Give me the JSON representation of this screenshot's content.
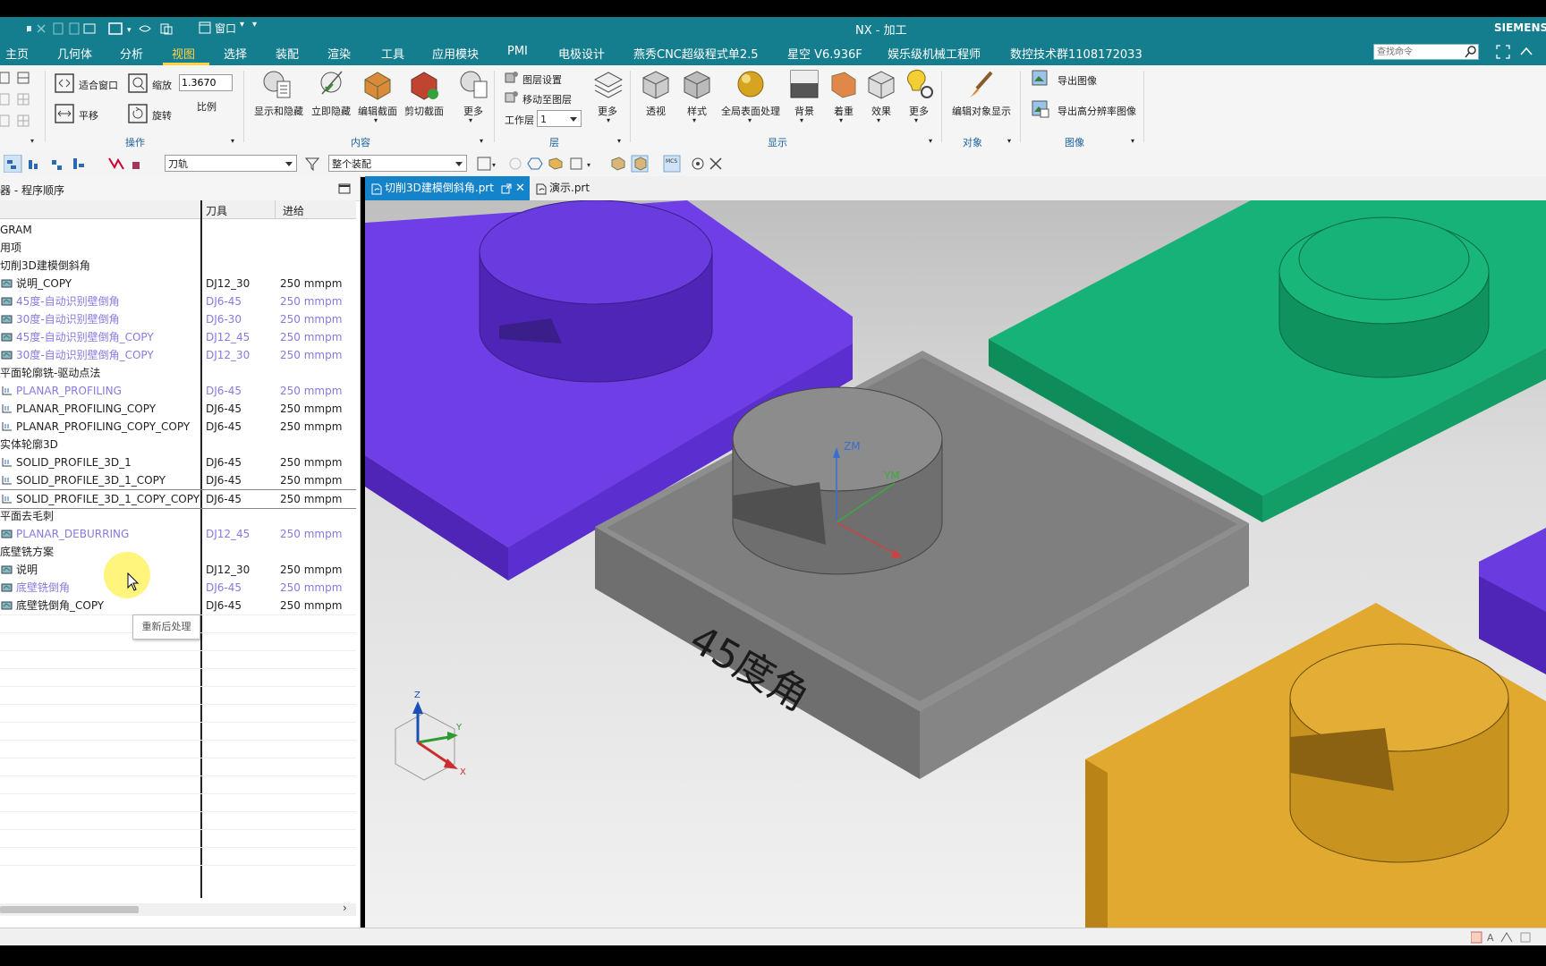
{
  "titlebar": {
    "title": "NX - 加工",
    "brand": "SIEMENS",
    "window_menu": "窗口"
  },
  "menubar": {
    "items": [
      "主页",
      "几何体",
      "分析",
      "视图",
      "选择",
      "装配",
      "渲染",
      "工具",
      "应用模块",
      "PMI",
      "电极设计",
      "燕秀CNC超级程式单2.5",
      "星空 V6.936F",
      "娱乐级机械工程师",
      "数控技术群1108172033"
    ],
    "active_index": 3,
    "search_placeholder": "查找命令"
  },
  "ribbon": {
    "operate": {
      "fit": "适合窗口",
      "zoom": "缩放",
      "zoom_value": "1.3670",
      "scale": "比例",
      "pan": "平移",
      "rotate": "旋转",
      "group": "操作"
    },
    "content": {
      "show_hide": "显示和隐藏",
      "immediate_hide": "立即隐藏",
      "edit_section": "编辑截面",
      "clip_section": "剪切截面",
      "more": "更多",
      "group": "内容"
    },
    "layer": {
      "settings": "图层设置",
      "move": "移动至图层",
      "work_layer_label": "工作层",
      "work_layer_value": "1",
      "more": "更多",
      "group": "层"
    },
    "display": {
      "perspective": "透视",
      "style": "样式",
      "global_surface": "全局表面处理",
      "background": "背景",
      "color": "着重",
      "effect": "效果",
      "more": "更多",
      "group": "显示"
    },
    "object": {
      "edit_display": "编辑对象显示",
      "group": "对象"
    },
    "image": {
      "export": "导出图像",
      "export_hi": "导出高分辨率图像",
      "group": "图像"
    }
  },
  "toolbar2": {
    "filter_value": "刀轨",
    "scope_value": "整个装配"
  },
  "navigator": {
    "title": "器 - 程序顺序",
    "col_tool": "刀具",
    "col_feed": "进给",
    "rows": [
      {
        "name": "GRAM",
        "tool": "",
        "feed": "",
        "muted": false,
        "icon": "none"
      },
      {
        "name": "用项",
        "tool": "",
        "feed": "",
        "muted": false,
        "icon": "none"
      },
      {
        "name": "切削3D建模倒斜角",
        "tool": "",
        "feed": "",
        "muted": false,
        "icon": "none"
      },
      {
        "name": "说明_COPY",
        "tool": "DJ12_30",
        "feed": "250 mmpm",
        "muted": false,
        "icon": "op"
      },
      {
        "name": "45度-自动识别壁倒角",
        "tool": "DJ6-45",
        "feed": "250 mmpm",
        "muted": true,
        "icon": "op"
      },
      {
        "name": "30度-自动识别壁倒角",
        "tool": "DJ6-30",
        "feed": "250 mmpm",
        "muted": true,
        "icon": "op"
      },
      {
        "name": "45度-自动识别壁倒角_COPY",
        "tool": "DJ12_45",
        "feed": "250 mmpm",
        "muted": true,
        "icon": "op"
      },
      {
        "name": "30度-自动识别壁倒角_COPY",
        "tool": "DJ12_30",
        "feed": "250 mmpm",
        "muted": true,
        "icon": "op"
      },
      {
        "name": "平面轮廓铣-驱动点法",
        "tool": "",
        "feed": "",
        "muted": false,
        "icon": "none"
      },
      {
        "name": "PLANAR_PROFILING",
        "tool": "DJ6-45",
        "feed": "250 mmpm",
        "muted": true,
        "icon": "prof"
      },
      {
        "name": "PLANAR_PROFILING_COPY",
        "tool": "DJ6-45",
        "feed": "250 mmpm",
        "muted": false,
        "icon": "prof"
      },
      {
        "name": "PLANAR_PROFILING_COPY_COPY",
        "tool": "DJ6-45",
        "feed": "250 mmpm",
        "muted": false,
        "icon": "prof"
      },
      {
        "name": "实体轮廓3D",
        "tool": "",
        "feed": "",
        "muted": false,
        "icon": "none"
      },
      {
        "name": "SOLID_PROFILE_3D_1",
        "tool": "DJ6-45",
        "feed": "250 mmpm",
        "muted": false,
        "icon": "prof"
      },
      {
        "name": "SOLID_PROFILE_3D_1_COPY",
        "tool": "DJ6-45",
        "feed": "250 mmpm",
        "muted": false,
        "icon": "prof"
      },
      {
        "name": "SOLID_PROFILE_3D_1_COPY_COPY",
        "tool": "DJ6-45",
        "feed": "250 mmpm",
        "muted": false,
        "icon": "prof"
      },
      {
        "name": "平面去毛刺",
        "tool": "",
        "feed": "",
        "muted": false,
        "icon": "none"
      },
      {
        "name": "PLANAR_DEBURRING",
        "tool": "DJ12_45",
        "feed": "250 mmpm",
        "muted": true,
        "icon": "op"
      },
      {
        "name": "底壁铣方案",
        "tool": "",
        "feed": "",
        "muted": false,
        "icon": "none"
      },
      {
        "name": "说明",
        "tool": "DJ12_30",
        "feed": "250 mmpm",
        "muted": false,
        "icon": "op"
      },
      {
        "name": "底壁铣倒角",
        "tool": "DJ6-45",
        "feed": "250 mmpm",
        "muted": true,
        "icon": "op"
      },
      {
        "name": "底壁铣倒角_COPY",
        "tool": "DJ6-45",
        "feed": "250 mmpm",
        "muted": false,
        "icon": "op"
      }
    ],
    "tooltip": "重新后处理"
  },
  "viewtabs": {
    "tabs": [
      "切削3D建模倒斜角.prt",
      "演示.prt"
    ]
  },
  "viewport": {
    "engraving": "45度角",
    "wcs_z": "ZM",
    "wcs_y": "YM",
    "triad_x": "X",
    "triad_y": "Y",
    "triad_z": "Z"
  },
  "colors": {
    "menubar": "#147d8e",
    "accent": "#ffd24a",
    "tab_active": "#1583c9",
    "part_purple": "#6a3ce0",
    "part_green": "#16b176",
    "part_gray": "#8a8a8a",
    "part_gold": "#d9a12e"
  }
}
